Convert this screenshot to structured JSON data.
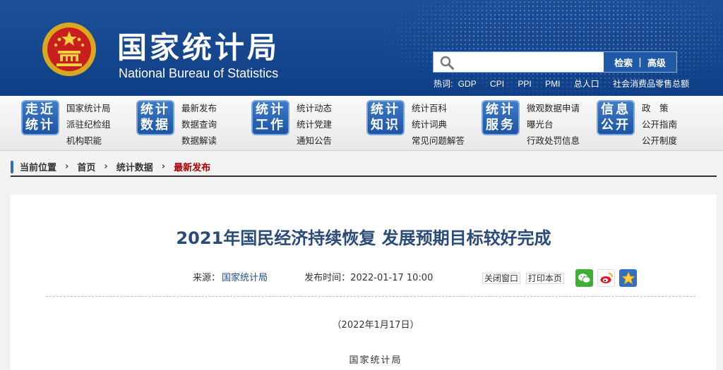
{
  "header": {
    "title_cn": "国家统计局",
    "title_en": "National Bureau of Statistics",
    "search": {
      "placeholder": "",
      "search_label": "检索",
      "separator": "|",
      "advanced_label": "高级"
    },
    "hotwords_label": "热词:",
    "hotwords": [
      "GDP",
      "CPI",
      "PPI",
      "PMI",
      "总人口",
      "社会消费品零售总额"
    ]
  },
  "nav": [
    {
      "badge": [
        "走近",
        "统计"
      ],
      "links": [
        "国家统计局",
        "派驻纪检组",
        "机构职能"
      ]
    },
    {
      "badge": [
        "统计",
        "数据"
      ],
      "links": [
        "最新发布",
        "数据查询",
        "数据解读"
      ]
    },
    {
      "badge": [
        "统计",
        "工作"
      ],
      "links": [
        "统计动态",
        "统计党建",
        "通知公告"
      ]
    },
    {
      "badge": [
        "统计",
        "知识"
      ],
      "links": [
        "统计百科",
        "统计词典",
        "常见问题解答"
      ]
    },
    {
      "badge": [
        "统计",
        "服务"
      ],
      "links": [
        "微观数据申请",
        "曝光台",
        "行政处罚信息"
      ]
    },
    {
      "badge": [
        "信息",
        "公开"
      ],
      "links": [
        "政　策",
        "公开指南",
        "公开制度"
      ]
    }
  ],
  "breadcrumb": {
    "label": "当前位置",
    "items": [
      "首页",
      "统计数据",
      "最新发布"
    ]
  },
  "article": {
    "title": "2021年国民经济持续恢复 发展预期目标较好完成",
    "source_label": "来源：",
    "source": "国家统计局",
    "date_label": "发布时间：",
    "date": "2022-01-17  10:00",
    "close_label": "关闭窗口",
    "print_label": "打印本页",
    "para_date": "（2022年1月17日）",
    "para_org": "国家统计局"
  },
  "icons": {
    "search": "search-icon",
    "wechat": "wechat-icon",
    "weibo": "weibo-icon",
    "favorite": "star-icon"
  },
  "colors": {
    "header_bg": "#1d4f98",
    "badge_bg": "#1d55a3",
    "title": "#2a4a7a",
    "current_crumb": "#a40000"
  }
}
